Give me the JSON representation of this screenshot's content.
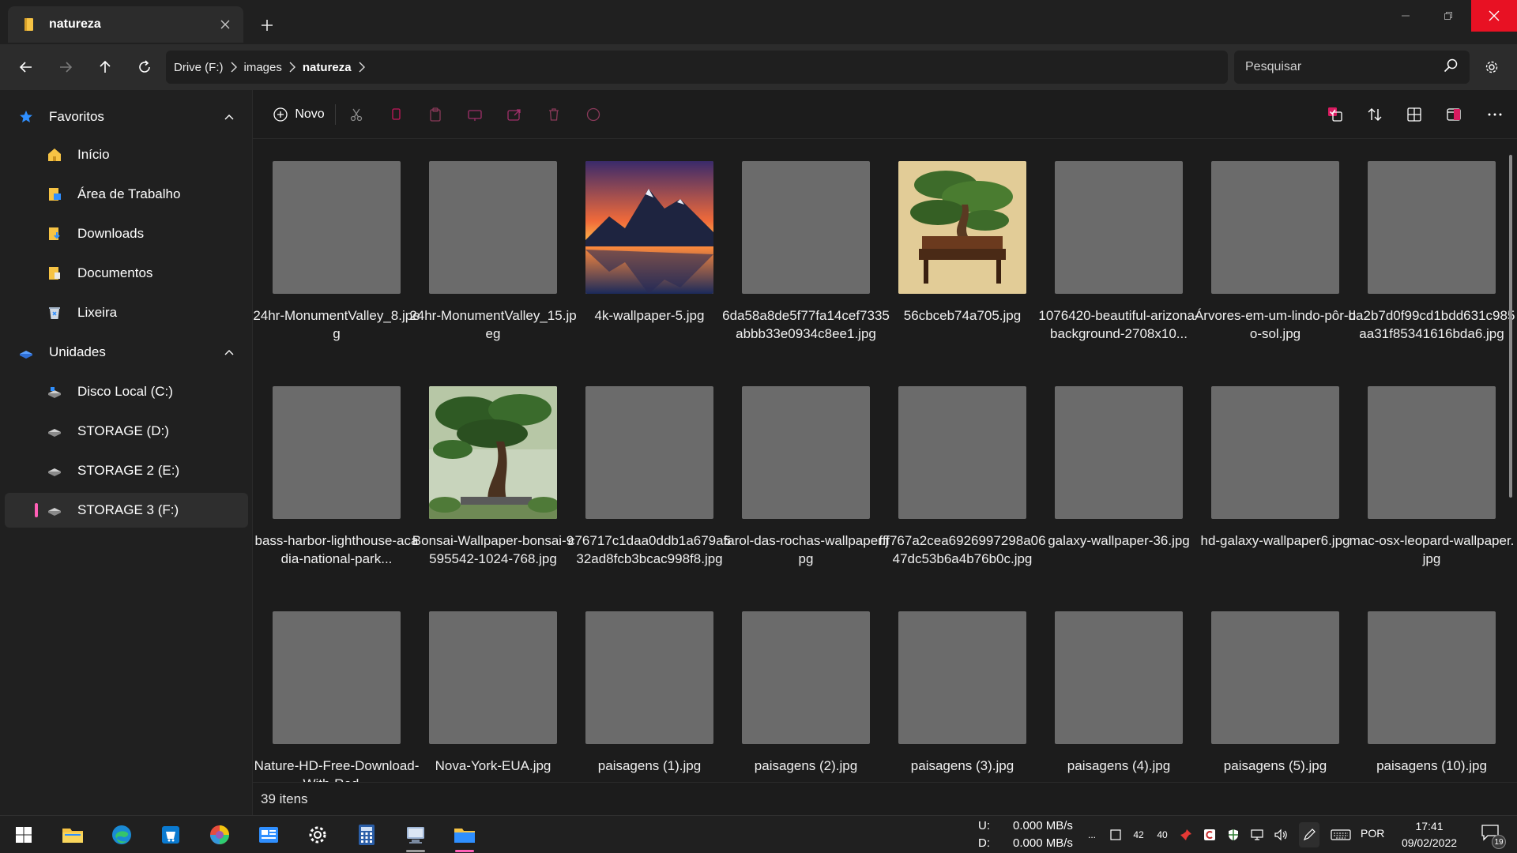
{
  "window": {
    "tab_title": "natureza",
    "tab_close_icon": "close-icon",
    "new_tab_icon": "plus-icon",
    "colors": {
      "accent": "#ff5fb6",
      "close_hover": "#e81123",
      "folder": "#f6c344"
    }
  },
  "nav": {
    "breadcrumb": [
      "Drive (F:)",
      "images",
      "natureza"
    ],
    "search_placeholder": "Pesquisar"
  },
  "sidebar": {
    "favorites_label": "Favoritos",
    "favorites": [
      {
        "label": "Início",
        "icon": "home-icon"
      },
      {
        "label": "Área de Trabalho",
        "icon": "desktop-folder-icon"
      },
      {
        "label": "Downloads",
        "icon": "downloads-folder-icon"
      },
      {
        "label": "Documentos",
        "icon": "documents-folder-icon"
      },
      {
        "label": "Lixeira",
        "icon": "recycle-bin-icon"
      }
    ],
    "drives_label": "Unidades",
    "drives": [
      {
        "label": "Disco Local (C:)",
        "icon": "system-drive-icon"
      },
      {
        "label": "STORAGE (D:)",
        "icon": "drive-icon"
      },
      {
        "label": "STORAGE 2 (E:)",
        "icon": "drive-icon"
      },
      {
        "label": "STORAGE 3 (F:)",
        "icon": "drive-icon",
        "selected": true
      }
    ]
  },
  "toolbar": {
    "new_label": "Novo"
  },
  "files": [
    {
      "name": "24hr-MonumentValley_8.jpeg",
      "thumb": "placeholder"
    },
    {
      "name": "24hr-MonumentValley_15.jpeg",
      "thumb": "placeholder"
    },
    {
      "name": "4k-wallpaper-5.jpg",
      "thumb": "mountain-lake"
    },
    {
      "name": "6da58a8de5f77fa14cef7335abbb33e0934c8ee1.jpg",
      "thumb": "placeholder"
    },
    {
      "name": "56cbceb74a705.jpg",
      "thumb": "bonsai-table"
    },
    {
      "name": "1076420-beautiful-arizona-background-2708x10...",
      "thumb": "placeholder"
    },
    {
      "name": "Árvores-em-um-lindo-pôr-do-sol.jpg",
      "thumb": "placeholder"
    },
    {
      "name": "ba2b7d0f99cd1bdd631c985aa31f85341616bda6.jpg",
      "thumb": "placeholder"
    },
    {
      "name": "bass-harbor-lighthouse-acadia-national-park...",
      "thumb": "placeholder"
    },
    {
      "name": "Bonsai-Wallpaper-bonsai-9595542-1024-768.jpg",
      "thumb": "bonsai-garden"
    },
    {
      "name": "c76717c1daa0ddb1a679a532ad8fcb3bcac998f8.jpg",
      "thumb": "placeholder"
    },
    {
      "name": "farol-das-rochas-wallpaper.jpg",
      "thumb": "placeholder"
    },
    {
      "name": "fff767a2cea6926997298a0647dc53b6a4b76b0c.jpg",
      "thumb": "placeholder"
    },
    {
      "name": "galaxy-wallpaper-36.jpg",
      "thumb": "placeholder"
    },
    {
      "name": "hd-galaxy-wallpaper6.jpg",
      "thumb": "placeholder"
    },
    {
      "name": "mac-osx-leopard-wallpaper.jpg",
      "thumb": "placeholder"
    },
    {
      "name": "Nature-HD-Free-Download-With-Red...",
      "thumb": "placeholder"
    },
    {
      "name": "Nova-York-EUA.jpg",
      "thumb": "placeholder"
    },
    {
      "name": "paisagens (1).jpg",
      "thumb": "placeholder"
    },
    {
      "name": "paisagens (2).jpg",
      "thumb": "placeholder"
    },
    {
      "name": "paisagens (3).jpg",
      "thumb": "placeholder"
    },
    {
      "name": "paisagens (4).jpg",
      "thumb": "placeholder"
    },
    {
      "name": "paisagens (5).jpg",
      "thumb": "placeholder"
    },
    {
      "name": "paisagens (10).jpg",
      "thumb": "placeholder"
    }
  ],
  "status": {
    "item_count": "39 itens"
  },
  "taskbar": {
    "apps": [
      "start-icon",
      "file-explorer-icon",
      "edge-icon",
      "store-icon",
      "color-picker-icon",
      "news-icon",
      "settings-icon",
      "calculator-icon",
      "remote-desktop-icon",
      "files-app-icon"
    ],
    "net_up_label": "U:",
    "net_up_value": "0.000 MB/s",
    "net_down_label": "D:",
    "net_down_value": "0.000 MB/s",
    "tray_overflow": "...",
    "tray_cpu": "42",
    "tray_gpu": "40",
    "language": "POR",
    "time": "17:41",
    "date": "09/02/2022",
    "notification_count": "19"
  }
}
